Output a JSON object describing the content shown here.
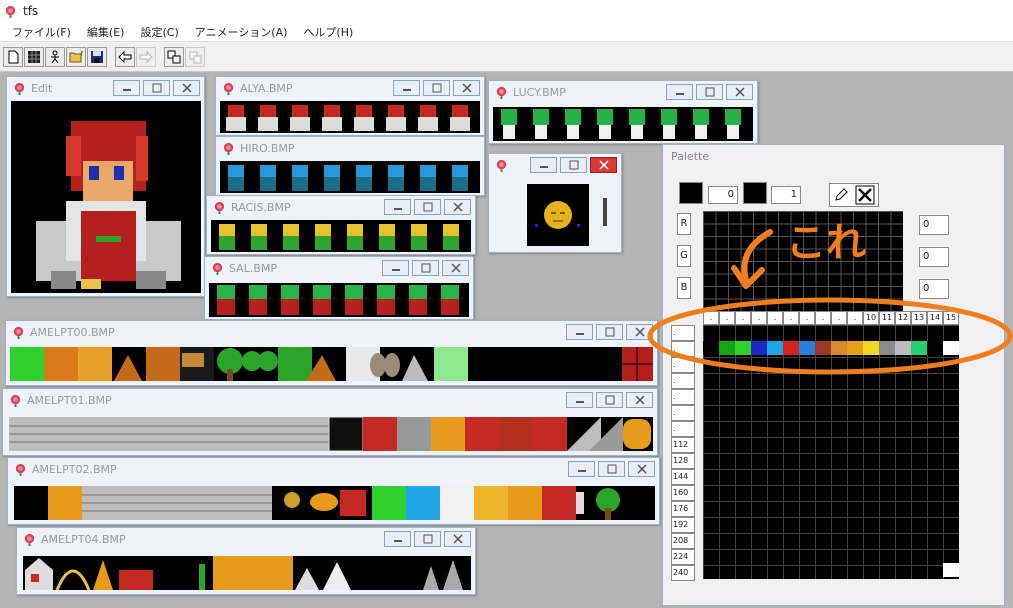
{
  "app": {
    "title": "tfs"
  },
  "menu": [
    "ファイル(F)",
    "編集(E)",
    "設定(C)",
    "アニメーション(A)",
    "ヘルプ(H)"
  ],
  "toolbar": [
    {
      "name": "new-file-icon"
    },
    {
      "name": "grid-icon"
    },
    {
      "name": "figure-icon"
    },
    {
      "name": "open-folder-icon"
    },
    {
      "name": "save-icon"
    },
    {
      "name": "arrow-left-icon"
    },
    {
      "name": "arrow-right-icon"
    },
    {
      "name": "copy-icon"
    },
    {
      "name": "paste-icon"
    }
  ],
  "windows": {
    "edit": "Edit",
    "alya": "ALYA.BMP",
    "hiro": "HIRO.BMP",
    "racis": "RACIS.BMP",
    "sal": "SAL.BMP",
    "lucy": "LUCY.BMP",
    "amelpt00": "AMELPT00.BMP",
    "amelpt01": "AMELPT01.BMP",
    "amelpt02": "AMELPT02.BMP",
    "amelpt04": "AMELPT04.BMP"
  },
  "palette": {
    "title": "Palette",
    "fg_index": "0",
    "bg_index": "1",
    "rgb_labels": [
      "R",
      "G",
      "B"
    ],
    "rgb_values": [
      "0",
      "0",
      "0"
    ],
    "col_labels": [
      ".",
      ".",
      ".",
      ".",
      ".",
      ".",
      ".",
      ".",
      ".",
      ".",
      "10",
      "11",
      "12",
      "13",
      "14",
      "15"
    ],
    "row_labels": [
      ".",
      ".",
      ".",
      ".",
      ".",
      ".",
      ".",
      "112",
      "128",
      "144",
      "160",
      "176",
      "192",
      "208",
      "224",
      "240"
    ],
    "colors": [
      "#000000",
      "#17a317",
      "#2ed12e",
      "#1c28c7",
      "#1ea5e6",
      "#d6231f",
      "#2a7fd6",
      "#9c3a2a",
      "#d78a2a",
      "#e3a018",
      "#f0d81a",
      "#8a8a8a",
      "#bcbcbc",
      "#21d16f",
      "#000000",
      "#ffffff"
    ]
  },
  "annotation": {
    "text": "これ"
  }
}
